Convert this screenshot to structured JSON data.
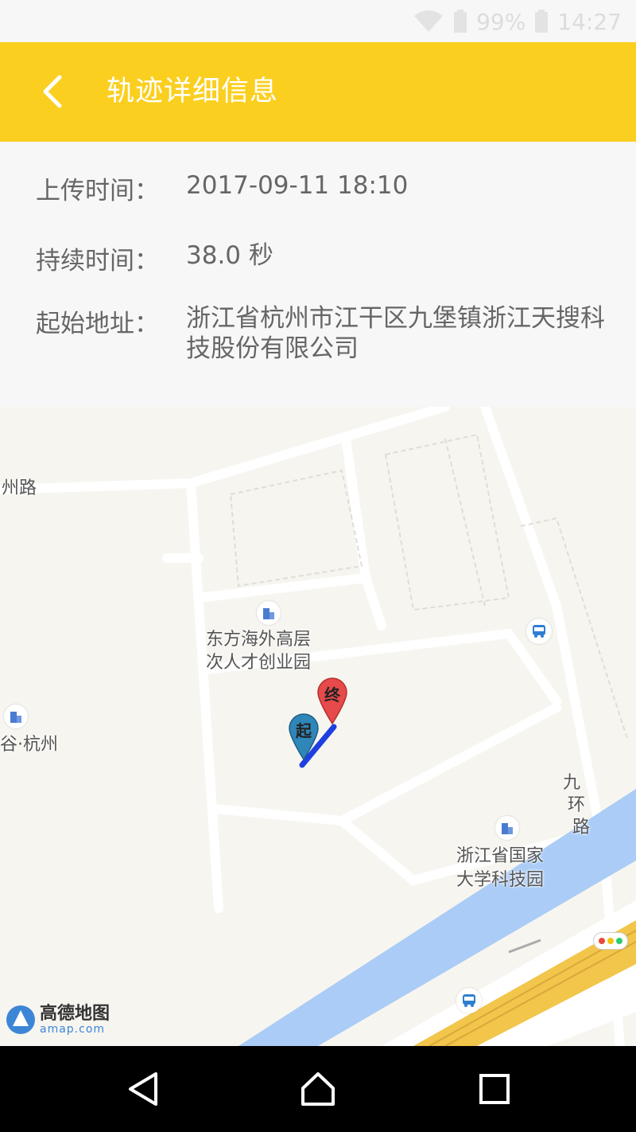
{
  "status_bar": {
    "battery_percent": "99%",
    "time": "14:27"
  },
  "app_bar": {
    "title": "轨迹详细信息",
    "color": "#fbcf1f"
  },
  "info": {
    "upload_time_label": "上传时间：",
    "upload_time_value": "2017-09-11 18:10",
    "duration_label": "持续时间：",
    "duration_value": "38.0 秒",
    "start_address_label": "起始地址：",
    "start_address_value": "浙江省杭州市江干区九堡镇浙江天搜科技股份有限公司"
  },
  "map": {
    "road_labels": {
      "left_road": "州路",
      "jiuhuan_road_1": "九",
      "jiuhuan_road_2": "环",
      "jiuhuan_road_3": "路"
    },
    "poi": {
      "dongfang_line1": "东方海外高层",
      "dongfang_line2": "次人才创业园",
      "left_poi": "谷·杭州",
      "zhejiang_line1": "浙江省国家",
      "zhejiang_line2": "大学科技园"
    },
    "markers": {
      "start": "起",
      "end": "终"
    },
    "logo": {
      "name": "高德地图",
      "domain": "amap.com"
    },
    "colors": {
      "river": "#aaccf6",
      "highway": "#f2c54b",
      "track": "#1e40e0",
      "start_marker": "#2f86b8",
      "end_marker": "#e64a4a"
    }
  }
}
